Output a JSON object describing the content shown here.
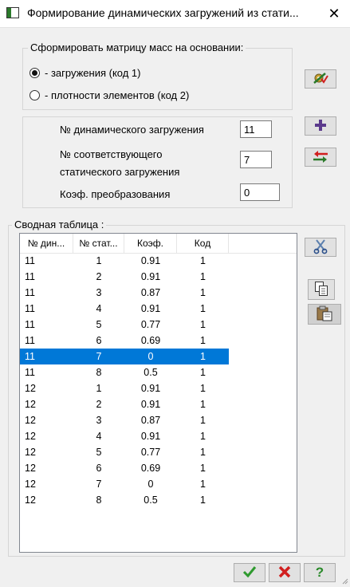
{
  "window": {
    "title": "Формирование динамических загружений из стати...",
    "close_glyph": "✕"
  },
  "mass_group": {
    "legend": "Сформировать матрицу масс на основании:",
    "options": [
      {
        "label": "- загружения (код 1)",
        "checked": true
      },
      {
        "label": "- плотности элементов (код 2)",
        "checked": false
      }
    ]
  },
  "params": {
    "dyn_label": "№ динамического загружения",
    "dyn_value": "11",
    "stat_label_1": "№ соответствующего",
    "stat_label_2": "статического загружения",
    "stat_value": "7",
    "coef_label": "Коэф. преобразования",
    "coef_value": "0"
  },
  "summary": {
    "legend": "Сводная таблица :",
    "columns": [
      "№ дин...",
      "№ стат...",
      "Коэф.",
      "Код"
    ],
    "rows": [
      [
        "11",
        "1",
        "0.91",
        "1"
      ],
      [
        "11",
        "2",
        "0.91",
        "1"
      ],
      [
        "11",
        "3",
        "0.87",
        "1"
      ],
      [
        "11",
        "4",
        "0.91",
        "1"
      ],
      [
        "11",
        "5",
        "0.77",
        "1"
      ],
      [
        "11",
        "6",
        "0.69",
        "1"
      ],
      [
        "11",
        "7",
        "0",
        "1"
      ],
      [
        "11",
        "8",
        "0.5",
        "1"
      ],
      [
        "12",
        "1",
        "0.91",
        "1"
      ],
      [
        "12",
        "2",
        "0.91",
        "1"
      ],
      [
        "12",
        "3",
        "0.87",
        "1"
      ],
      [
        "12",
        "4",
        "0.91",
        "1"
      ],
      [
        "12",
        "5",
        "0.77",
        "1"
      ],
      [
        "12",
        "6",
        "0.69",
        "1"
      ],
      [
        "12",
        "7",
        "0",
        "1"
      ],
      [
        "12",
        "8",
        "0.5",
        "1"
      ]
    ],
    "selected_row": 6
  },
  "icons": {
    "generate": "gear-check-icon",
    "add": "plus-icon",
    "replace": "swap-arrows-icon",
    "delete": "scissors-icon",
    "copy": "copy-icon",
    "paste": "paste-icon",
    "ok": "check-icon",
    "cancel": "cross-icon",
    "help": "question-icon"
  },
  "colors": {
    "selection": "#0078d7",
    "ok_green": "#2e9a2e",
    "cancel_red": "#d11f1f",
    "help_green": "#2a8a2a",
    "add_purple": "#5b3a8c"
  }
}
